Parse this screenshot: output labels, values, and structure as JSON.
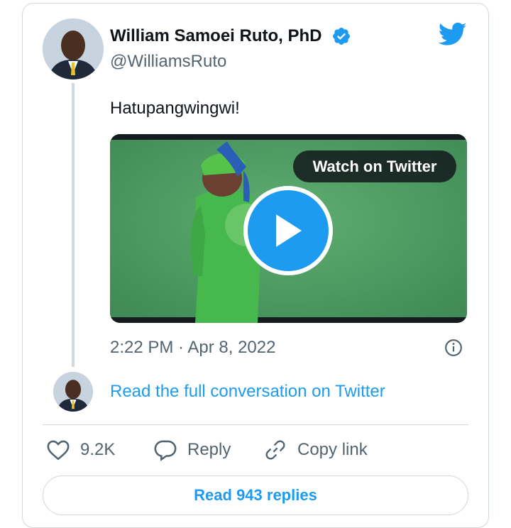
{
  "author": {
    "name": "William Samoei Ruto, PhD",
    "handle": "@WilliamsRuto",
    "verified": true
  },
  "tweet": {
    "text": "Hatupangwingwi!",
    "timestamp": "2:22 PM · Apr 8, 2022"
  },
  "media": {
    "watch_label": "Watch on Twitter",
    "type": "video"
  },
  "conversation": {
    "read_full_label": "Read the full conversation on Twitter"
  },
  "actions": {
    "likes_count": "9.2K",
    "reply_label": "Reply",
    "copy_link_label": "Copy link"
  },
  "replies": {
    "read_label": "Read 943 replies"
  },
  "colors": {
    "accent": "#1d9bf0",
    "text_primary": "#0f1419",
    "text_secondary": "#536471",
    "border": "#cfd9de"
  },
  "icons": [
    "twitter-bird-icon",
    "verified-badge-icon",
    "play-icon",
    "info-icon",
    "heart-icon",
    "reply-bubble-icon",
    "link-icon"
  ]
}
